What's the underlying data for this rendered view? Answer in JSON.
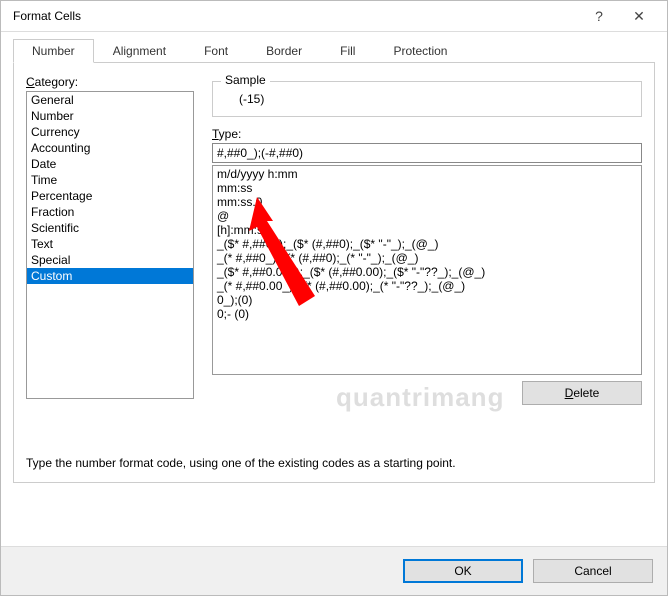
{
  "window": {
    "title": "Format Cells",
    "help": "?",
    "close": "✕"
  },
  "tabs": [
    {
      "label": "Number",
      "active": true
    },
    {
      "label": "Alignment",
      "active": false
    },
    {
      "label": "Font",
      "active": false
    },
    {
      "label": "Border",
      "active": false
    },
    {
      "label": "Fill",
      "active": false
    },
    {
      "label": "Protection",
      "active": false
    }
  ],
  "labels": {
    "category": "Category:",
    "sample": "Sample",
    "type": "Type:",
    "hint": "Type the number format code, using one of the existing codes as a starting point."
  },
  "categories": [
    {
      "name": "General",
      "selected": false
    },
    {
      "name": "Number",
      "selected": false
    },
    {
      "name": "Currency",
      "selected": false
    },
    {
      "name": "Accounting",
      "selected": false
    },
    {
      "name": "Date",
      "selected": false
    },
    {
      "name": "Time",
      "selected": false
    },
    {
      "name": "Percentage",
      "selected": false
    },
    {
      "name": "Fraction",
      "selected": false
    },
    {
      "name": "Scientific",
      "selected": false
    },
    {
      "name": "Text",
      "selected": false
    },
    {
      "name": "Special",
      "selected": false
    },
    {
      "name": "Custom",
      "selected": true
    }
  ],
  "sample_value": "(-15)",
  "type_value": "#,##0_);(-#,##0)",
  "formats": [
    "m/d/yyyy h:mm",
    "mm:ss",
    "mm:ss.0",
    "@",
    "[h]:mm:ss",
    "_($* #,##0_);_($* (#,##0);_($* \"-\"_);_(@_)",
    "_(* #,##0_);_(* (#,##0);_(* \"-\"_);_(@_)",
    "_($* #,##0.00_);_($* (#,##0.00);_($* \"-\"??_);_(@_)",
    "_(* #,##0.00_);_(* (#,##0.00);_(* \"-\"??_);_(@_)",
    "0_);(0)",
    "0;- (0)"
  ],
  "buttons": {
    "delete": "Delete",
    "ok": "OK",
    "cancel": "Cancel"
  },
  "watermark": "quantrimang"
}
